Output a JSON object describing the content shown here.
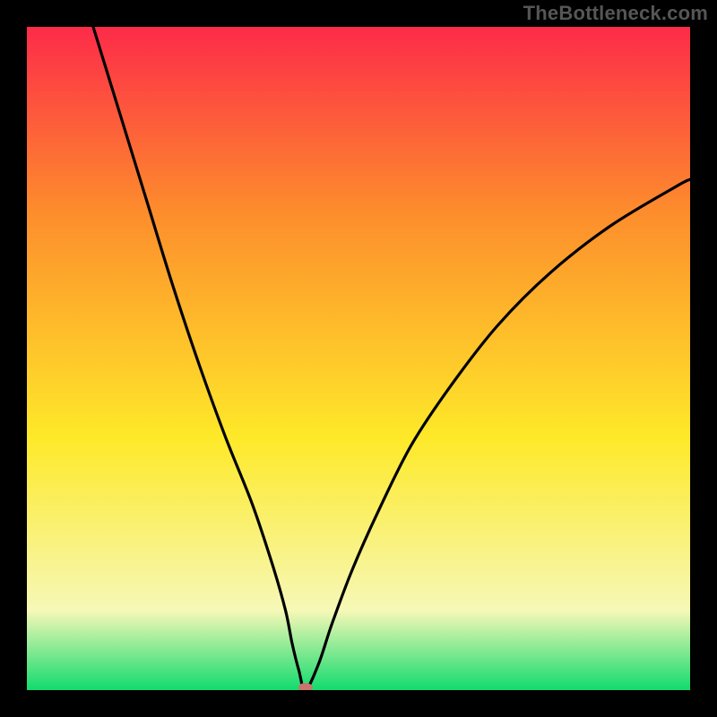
{
  "attribution": "TheBottleneck.com",
  "chart_data": {
    "type": "line",
    "title": "",
    "xlabel": "",
    "ylabel": "",
    "xlim": [
      0,
      100
    ],
    "ylim": [
      0,
      100
    ],
    "grid": false,
    "background": "rainbow-vertical-red-to-green",
    "curve_note": "V-shaped bottleneck curve; y≈0 at x≈42 (minimum marked with dot)",
    "x": [
      10,
      14,
      18,
      22,
      26,
      30,
      34,
      37,
      39,
      40,
      41,
      42,
      44,
      46,
      49,
      53,
      58,
      64,
      71,
      79,
      88,
      98,
      100
    ],
    "values": [
      100,
      87,
      74,
      61,
      49,
      38,
      28,
      19,
      12,
      7,
      3,
      0,
      4,
      10,
      18,
      27,
      37,
      46,
      55,
      63,
      70,
      76,
      77
    ],
    "marker": {
      "x": 42,
      "y": 0,
      "color": "#c9746e",
      "rx": 8,
      "ry": 5
    }
  },
  "colors": {
    "frame": "#000000",
    "curve": "#000000",
    "grad_top": "#fd2b49",
    "grad_mid1": "#fd8d2c",
    "grad_mid2": "#fee929",
    "grad_low": "#f6f8b7",
    "grad_bottom": "#12db6e",
    "marker": "#c9746e"
  }
}
